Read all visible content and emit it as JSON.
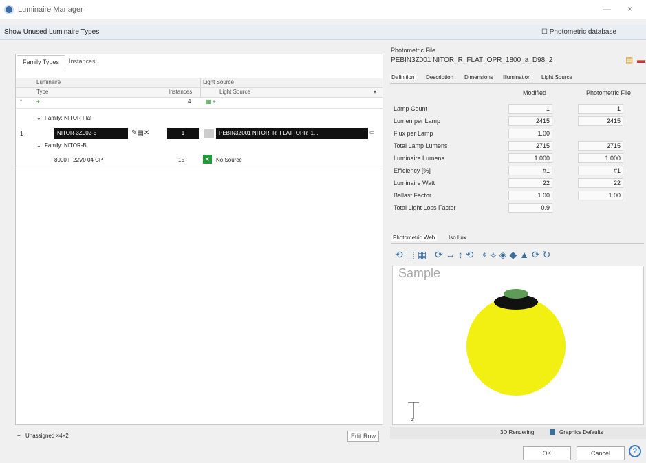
{
  "window": {
    "title": "Luminaire Manager",
    "min": "—",
    "close": "×"
  },
  "toolbar": {
    "show_unused": "Show Unused Luminaire Types",
    "photometric_db": "Photometric database"
  },
  "tabs": [
    "Family Types",
    "Instances"
  ],
  "table": {
    "group1": "Luminaire",
    "group2": "Light Source",
    "col_type": "Type",
    "col_instances": "Instances",
    "col_light": "Light Source",
    "filter_row_index": "*",
    "filter_instances": "4",
    "family1": "Family: NITOR Flat",
    "row1_index": "1",
    "row1_type": "NITOR-3Z002-5",
    "row1_instances": "1",
    "row1_source": "PEBIN3Z001 NITOR_R_FLAT_OPR_1...",
    "family2": "Family: NITOR-B",
    "row2_type": "8000 F 22V0 04 CP",
    "row2_instances": "15",
    "row2_source": "No Source"
  },
  "footer": {
    "unassigned": "Unassigned ×4×2",
    "action": "Edit Row"
  },
  "photometric": {
    "label": "Photometric File",
    "file": "PEBIN3Z001 NITOR_R_FLAT_OPR_1800_a_D98_2",
    "tabs": [
      "Definition",
      "Description",
      "Dimensions",
      "Illumination",
      "Light Source"
    ],
    "col_modified": "Modified",
    "col_file": "Photometric File",
    "rows": [
      {
        "label": "Lamp Count",
        "modified": "1",
        "file": "1"
      },
      {
        "label": "Lumen per Lamp",
        "modified": "2415",
        "file": "2415"
      },
      {
        "label": "Flux per Lamp",
        "modified": "1.00",
        "file": ""
      },
      {
        "label": "Total Lamp Lumens",
        "modified": "2715",
        "file": "2715"
      },
      {
        "label": "Luminaire Lumens",
        "modified": "1.000",
        "file": "1.000"
      },
      {
        "label": "Efficiency [%]",
        "modified": "#1",
        "file": "#1"
      },
      {
        "label": "Luminaire Watt",
        "modified": "22",
        "file": "22"
      },
      {
        "label": "Ballast Factor",
        "modified": "1.00",
        "file": "1.00"
      },
      {
        "label": "Total Light Loss Factor",
        "modified": "0.9",
        "file": ""
      }
    ],
    "viz_tabs": [
      "Photometric Web",
      "Iso Lux"
    ],
    "sample": "Sample",
    "axis": "z",
    "render_mode": "3D Rendering",
    "color_scheme": "Graphics Defaults"
  },
  "buttons": {
    "ok": "OK",
    "cancel": "Cancel",
    "help": "?"
  },
  "colors": {
    "bulb": "#f2ef12",
    "select": "#111111"
  }
}
